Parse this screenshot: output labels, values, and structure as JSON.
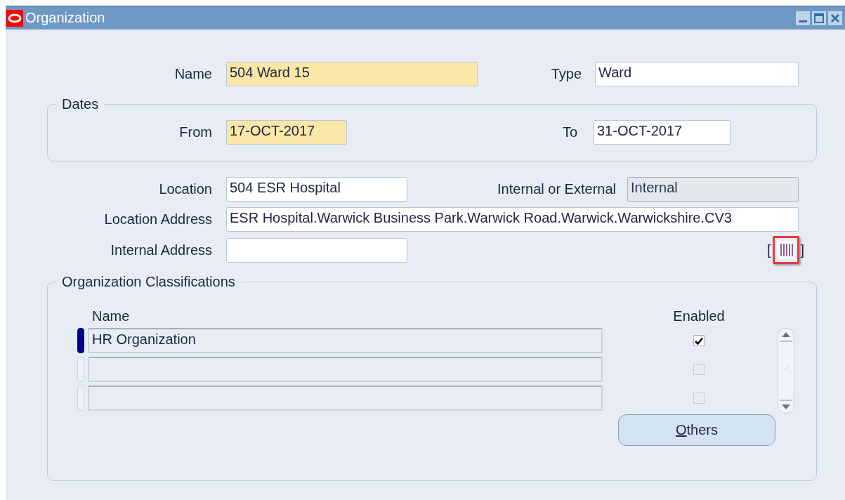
{
  "window": {
    "title": "Organization"
  },
  "header": {
    "name": {
      "label": "Name",
      "value": "504 Ward 15",
      "required": true
    },
    "type": {
      "label": "Type",
      "value": "Ward",
      "required": false
    }
  },
  "dates": {
    "legend": "Dates",
    "from": {
      "label": "From",
      "value": "17-OCT-2017",
      "required": true
    },
    "to": {
      "label": "To",
      "value": "31-OCT-2017",
      "required": false
    }
  },
  "location": {
    "label": "Location",
    "value": "504 ESR Hospital",
    "disabled": false
  },
  "internal_or_external": {
    "label": "Internal or External",
    "value": "Internal",
    "disabled": true
  },
  "location_address": {
    "label": "Location Address",
    "value": "ESR Hospital.Warwick Business Park.Warwick Road.Warwick.Warwickshire.CV3"
  },
  "internal_address": {
    "label": "Internal Address"
  },
  "flexfield": {
    "open": "[",
    "close": "]",
    "highlighted": true
  },
  "classifications": {
    "legend": "Organization Classifications",
    "columns": [
      "Name",
      "Enabled"
    ],
    "rows": [
      {
        "name": "HR Organization",
        "enabled": true,
        "selected": true
      },
      {
        "enabled": false,
        "selected": false
      },
      {
        "enabled": false,
        "selected": false
      }
    ],
    "button": {
      "label": "Others"
    }
  }
}
